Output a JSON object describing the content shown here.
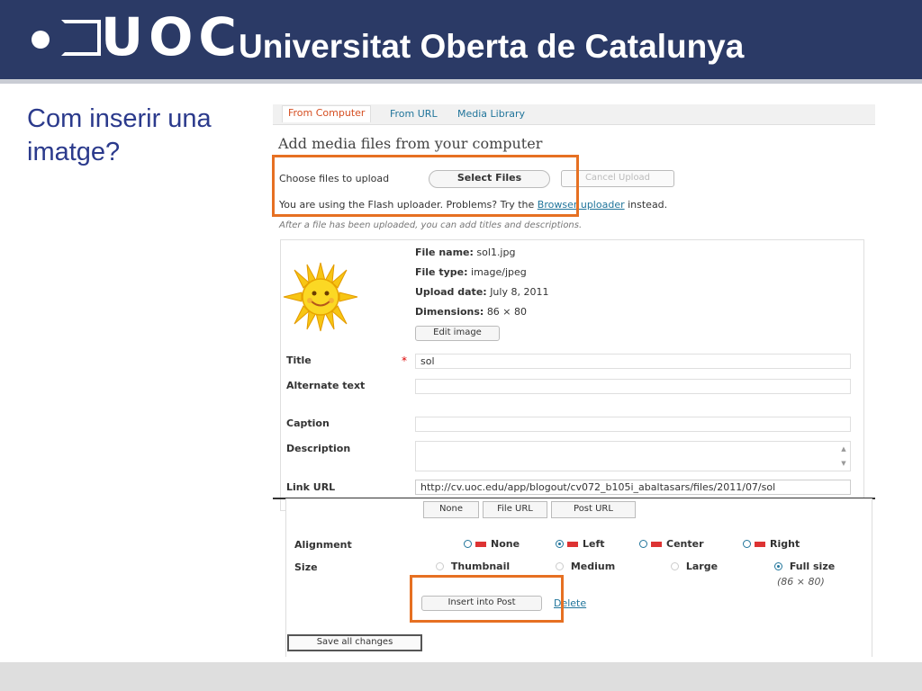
{
  "slide": {
    "logo_text": "UOC",
    "university": "Universitat Oberta de Catalunya",
    "question": "Com inserir una imatge?"
  },
  "tabs": [
    {
      "label": "From Computer",
      "active": true
    },
    {
      "label": "From URL",
      "active": false
    },
    {
      "label": "Media Library",
      "active": false
    }
  ],
  "upload": {
    "heading": "Add media files from your computer",
    "choose_label": "Choose files to upload",
    "select_button": "Select Files",
    "cancel_button": "Cancel Upload",
    "flash_prefix": "You are using the Flash uploader. Problems? Try the ",
    "flash_link": "Browser uploader",
    "flash_suffix": " instead.",
    "after_note": "After a file has been uploaded, you can add titles and descriptions."
  },
  "file": {
    "name_label": "File name:",
    "name_value": "sol1.jpg",
    "type_label": "File type:",
    "type_value": "image/jpeg",
    "date_label": "Upload date:",
    "date_value": "July 8, 2011",
    "dim_label": "Dimensions:",
    "dim_value": "86 × 80",
    "edit_button": "Edit image"
  },
  "form": {
    "title_label": "Title",
    "title_required": "*",
    "title_value": "sol",
    "alt_label": "Alternate text",
    "alt_value": "",
    "caption_label": "Caption",
    "caption_value": "",
    "description_label": "Description",
    "description_value": "",
    "link_label": "Link URL",
    "link_value": "http://cv.uoc.edu/app/blogout/cv072_b105i_abaltasars/files/2011/07/sol",
    "link_buttons": [
      "None",
      "File URL",
      "Post URL"
    ]
  },
  "alignment": {
    "label": "Alignment",
    "options": [
      {
        "label": "None",
        "selected": false
      },
      {
        "label": "Left",
        "selected": true
      },
      {
        "label": "Center",
        "selected": false
      },
      {
        "label": "Right",
        "selected": false
      }
    ]
  },
  "size": {
    "label": "Size",
    "options": [
      {
        "label": "Thumbnail",
        "selected": false
      },
      {
        "label": "Medium",
        "selected": false
      },
      {
        "label": "Large",
        "selected": false
      },
      {
        "label": "Full size",
        "selected": true
      }
    ],
    "full_note": "(86 × 80)"
  },
  "actions": {
    "insert_button": "Insert into Post",
    "delete_link": "Delete",
    "save_button": "Save all changes"
  },
  "colors": {
    "header_bg": "#2b3a66",
    "highlight": "#e67022",
    "link": "#21759b"
  }
}
